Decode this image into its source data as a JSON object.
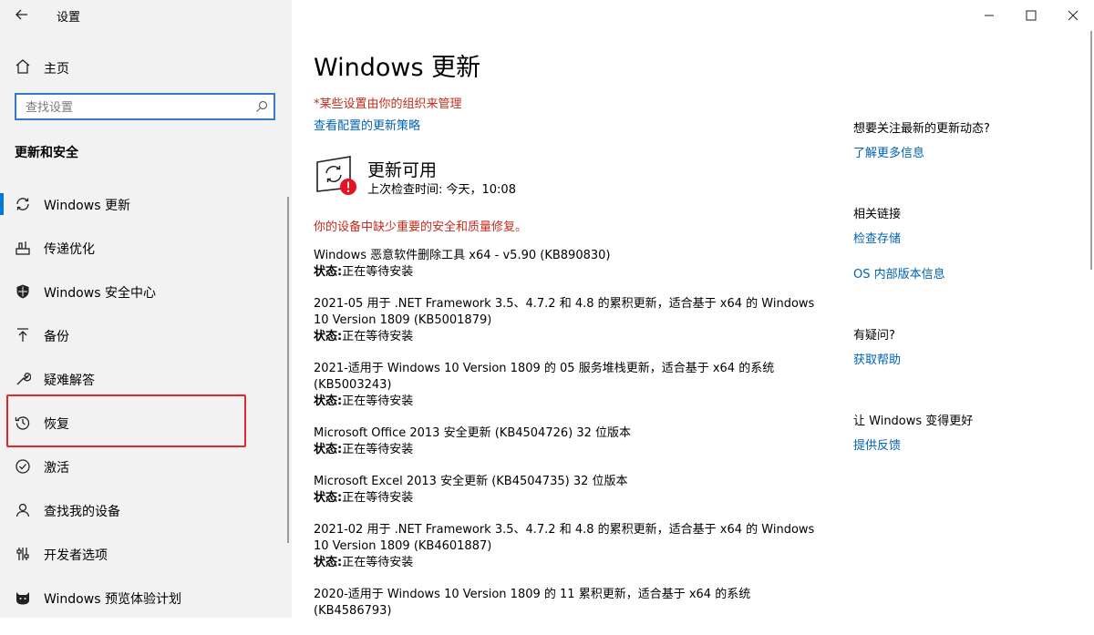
{
  "app": {
    "title": "设置"
  },
  "sidebar": {
    "home_label": "主页",
    "search_placeholder": "查找设置",
    "section_title": "更新和安全",
    "items": [
      {
        "label": "Windows 更新",
        "icon": "sync-icon"
      },
      {
        "label": "传递优化",
        "icon": "delivery-optimization-icon"
      },
      {
        "label": "Windows 安全中心",
        "icon": "shield-icon"
      },
      {
        "label": "备份",
        "icon": "backup-arrow-icon"
      },
      {
        "label": "疑难解答",
        "icon": "wrench-icon"
      },
      {
        "label": "恢复",
        "icon": "history-icon"
      },
      {
        "label": "激活",
        "icon": "check-circle-icon"
      },
      {
        "label": "查找我的设备",
        "icon": "person-pin-icon"
      },
      {
        "label": "开发者选项",
        "icon": "developer-icon"
      },
      {
        "label": "Windows 预览体验计划",
        "icon": "insider-cat-icon"
      }
    ]
  },
  "main": {
    "title": "Windows 更新",
    "managed_notice": "*某些设置由你的组织来管理",
    "policy_link": "查看配置的更新策略",
    "status_title": "更新可用",
    "status_subtitle": "上次检查时间: 今天，10:08",
    "warning": "你的设备中缺少重要的安全和质量修复。",
    "status_label": "状态:",
    "updates": [
      {
        "name": "Windows 恶意软件删除工具 x64 - v5.90 (KB890830)",
        "status": "正在等待安装"
      },
      {
        "name": "2021-05 用于 .NET Framework 3.5、4.7.2 和 4.8 的累积更新，适合基于 x64 的 Windows 10 Version 1809 (KB5001879)",
        "status": "正在等待安装"
      },
      {
        "name": "2021-适用于 Windows 10 Version 1809 的 05 服务堆栈更新，适合基于 x64 的系统 (KB5003243)",
        "status": "正在等待安装"
      },
      {
        "name": "Microsoft Office 2013 安全更新 (KB4504726) 32 位版本",
        "status": "正在等待安装"
      },
      {
        "name": "Microsoft Excel 2013 安全更新 (KB4504735) 32 位版本",
        "status": "正在等待安装"
      },
      {
        "name": "2021-02 用于 .NET Framework 3.5、4.7.2 和 4.8 的累积更新，适合基于 x64 的 Windows 10 Version 1809 (KB4601887)",
        "status": "正在等待安装"
      },
      {
        "name": "2020-适用于 Windows 10 Version 1809 的 11 累积更新，适合基于 x64 的系统 (KB4586793)",
        "status": ""
      }
    ]
  },
  "right": {
    "q1": "想要关注最新的更新动态?",
    "q1_link": "了解更多信息",
    "related": "相关链接",
    "related_links": [
      "检查存储",
      "OS 内部版本信息"
    ],
    "help_q": "有疑问?",
    "help_link": "获取帮助",
    "improve": "让 Windows 变得更好",
    "feedback_link": "提供反馈"
  },
  "colors": {
    "accent": "#0078d7",
    "link": "#0063b1",
    "warning": "#c42b1c",
    "highlight": "#e0282e",
    "sidebar_bg": "#f2f2f2"
  }
}
